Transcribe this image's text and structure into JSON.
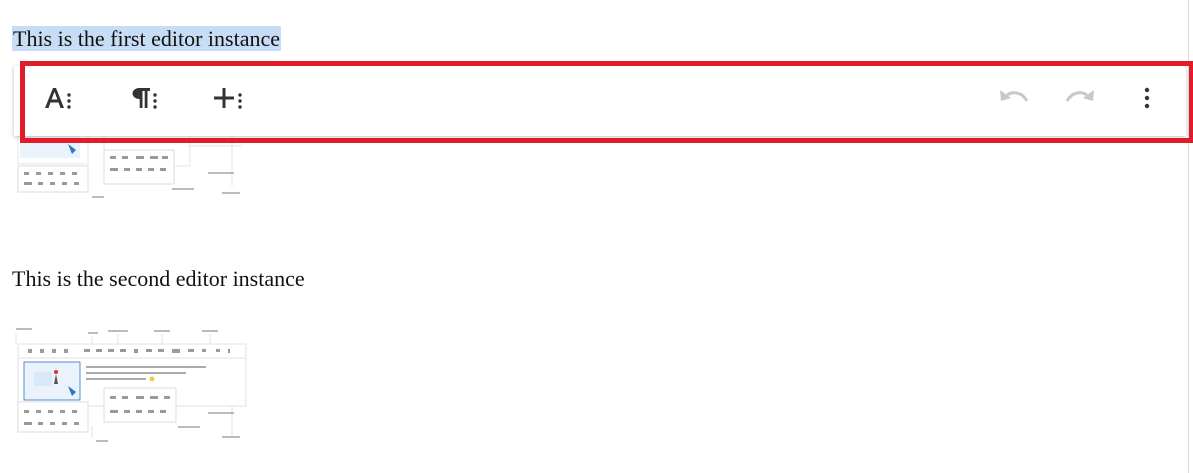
{
  "editors": [
    {
      "text": "This is the first editor instance"
    },
    {
      "text": "This is the second editor instance"
    }
  ],
  "toolbar": {
    "buttons": [
      {
        "name": "text-format",
        "icon": "text-format-icon"
      },
      {
        "name": "paragraph-format",
        "icon": "paragraph-format-icon"
      },
      {
        "name": "insert-more",
        "icon": "plus-more-icon"
      },
      {
        "name": "undo",
        "icon": "undo-icon",
        "state": "disabled"
      },
      {
        "name": "redo",
        "icon": "redo-icon",
        "state": "disabled"
      },
      {
        "name": "more",
        "icon": "more-vertical-icon"
      }
    ],
    "highlight_color": "#e01b2a"
  },
  "colors": {
    "selection": "#c7dcf5",
    "icon": "#333333",
    "icon_disabled": "#c8c8c8"
  }
}
